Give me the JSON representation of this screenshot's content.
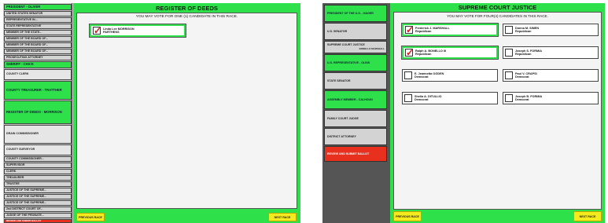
{
  "left": {
    "title": "REGISTER OF DEEDS",
    "instruction": "YOU MAY VOTE FOR ONE (1) CANDIDATE IN THIS RACE.",
    "candidate": {
      "name": "Linda Lee MORRISON",
      "party": "PARTHENS",
      "checked": true
    },
    "sidebar": [
      "PRESIDENT - OLIVER",
      "UNITED STATES SENATOR",
      "REPRESENTATIVE IN...",
      "STATE REPRESENTATIVE",
      "MEMBER OF THE STATE...",
      "MEMBER OF THE BOARD OF...",
      "MEMBER OF THE BOARD OF...",
      "MEMBER OF THE BOARD OF...",
      "PROSECUTING ATTORNEY",
      "SHERIFF - CHICK",
      "COUNTY CLERK",
      "COUNTY TREASURER - TRATTHER",
      "REGISTER OF DEEDS - MORRISON",
      "DRAIN COMMISSIONER",
      "COUNTY SURVEYOR",
      "COUNTY COMMISSIONER...",
      "SUPERVISOR",
      "CLERK",
      "TREASURER",
      "TRUSTEE",
      "JUSTICE OF THE SUPREME...",
      "JUSTICE OF THE SUPREME...",
      "JUSTICE OF THE SUPREME...",
      "2nd DISTRICT COURT OF...",
      "JUDGE OF THE PROBATE...",
      "REVIEW AND SUBMIT BALLOT"
    ],
    "prev_label": "PREVIOUS RACE",
    "next_label": "NEXT RACE"
  },
  "right": {
    "title": "SUPREME COURT JUSTICE",
    "instruction": "YOU MAY VOTE FOR FOUR(4) CANDIDATES IN THIS RACE.",
    "sidebar": [
      "PRESIDENT OF THE U.S. - HAGER",
      "U.S. SENATOR",
      "SUPREME COURT JUSTICE",
      "U.S. REPRESENTATIVE - OLINS",
      "STATE SENATOR",
      "ASSEMBLY MEMBER - CALHOUN",
      "FAMILY COURT JUDGE",
      "DISTRICT ATTORNEY",
      "REVIEW AND SUBMIT BALLOT"
    ],
    "sidebar_sub": "BONELLO  MARSHALL",
    "candidates": [
      {
        "name": "Frederick J. MARSHALL",
        "party": "Republican",
        "checked": true
      },
      {
        "name": "Donna M. SIMEN",
        "party": "Republican",
        "checked": false
      },
      {
        "name": "Ralph A. BONELLO III",
        "party": "Republican",
        "checked": true
      },
      {
        "name": "Joseph S. FORMIA",
        "party": "Republican",
        "checked": false
      },
      {
        "name": "E. Jeannetta OGDEN",
        "party": "Democrat",
        "checked": false
      },
      {
        "name": "Paul V. CRAPSI",
        "party": "Democrat",
        "checked": false
      },
      {
        "name": "Sheila A. DITULLIO",
        "party": "Democrat",
        "checked": false
      },
      {
        "name": "Joseph B. FORMIA",
        "party": "Democrat",
        "checked": false
      }
    ],
    "prev_label": "PREVIOUS RACE",
    "next_label": "NEXT RACE"
  },
  "colors": {
    "accent_green": "#2ee04a",
    "alert_red": "#e8301f",
    "nav_yellow": "#f5ea1e",
    "check_red": "#d41a1a"
  },
  "icons": {
    "check": "checkmark-icon"
  }
}
